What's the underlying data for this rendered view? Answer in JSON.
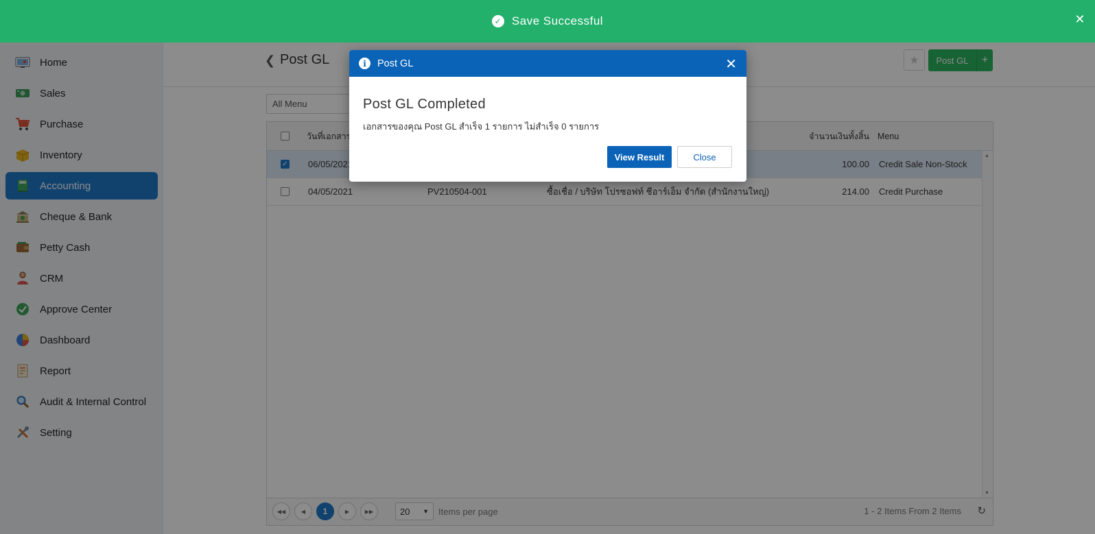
{
  "toast": {
    "message": "Save Successful",
    "close_icon": "close-icon"
  },
  "sidebar": {
    "items": [
      {
        "label": "Home",
        "icon": "home-icon"
      },
      {
        "label": "Sales",
        "icon": "money-icon"
      },
      {
        "label": "Purchase",
        "icon": "cart-icon"
      },
      {
        "label": "Inventory",
        "icon": "box-icon"
      },
      {
        "label": "Accounting",
        "icon": "ledger-icon",
        "active": true
      },
      {
        "label": "Cheque & Bank",
        "icon": "bank-icon"
      },
      {
        "label": "Petty Cash",
        "icon": "wallet-icon"
      },
      {
        "label": "CRM",
        "icon": "people-icon"
      },
      {
        "label": "Approve Center",
        "icon": "check-circle-icon"
      },
      {
        "label": "Dashboard",
        "icon": "pie-chart-icon"
      },
      {
        "label": "Report",
        "icon": "report-icon"
      },
      {
        "label": "Audit & Internal Control",
        "icon": "magnifier-icon"
      },
      {
        "label": "Setting",
        "icon": "tools-icon"
      }
    ]
  },
  "header": {
    "title": "Post GL",
    "action_label": "Post GL",
    "add_label": "+"
  },
  "filter": {
    "value": "All Menu"
  },
  "grid": {
    "columns": {
      "date": "วันที่เอกสาร",
      "amount": "จำนวนเงินทั้งสิ้น",
      "menu": "Menu"
    },
    "rows": [
      {
        "date": "06/05/2021",
        "doc": "",
        "desc": "",
        "amount": "100.00",
        "menu": "Credit Sale Non-Stock",
        "checked": true
      },
      {
        "date": "04/05/2021",
        "doc": "PV210504-001",
        "desc": "ซื้อเชื่อ / บริษัท โปรซอฟท์ ชีอาร์เอ็ม จำกัด (สำนักงานใหญ่)",
        "amount": "214.00",
        "menu": "Credit Purchase",
        "checked": false
      }
    ]
  },
  "pager": {
    "current_page": "1",
    "per_page": "20",
    "per_page_label": "Items per page",
    "info": "1 - 2 Items From 2 Items"
  },
  "modal": {
    "header": "Post GL",
    "title": "Post GL Completed",
    "message": "เอกสารของคุณ Post GL สำเร็จ 1 รายการ ไม่สำเร็จ 0 รายการ",
    "view_label": "View Result",
    "close_label": "Close"
  },
  "colors": {
    "toast": "#22b06b",
    "modal_header": "#0a63b7",
    "accent": "#1f78c9",
    "post_button": "#2cb55f"
  }
}
